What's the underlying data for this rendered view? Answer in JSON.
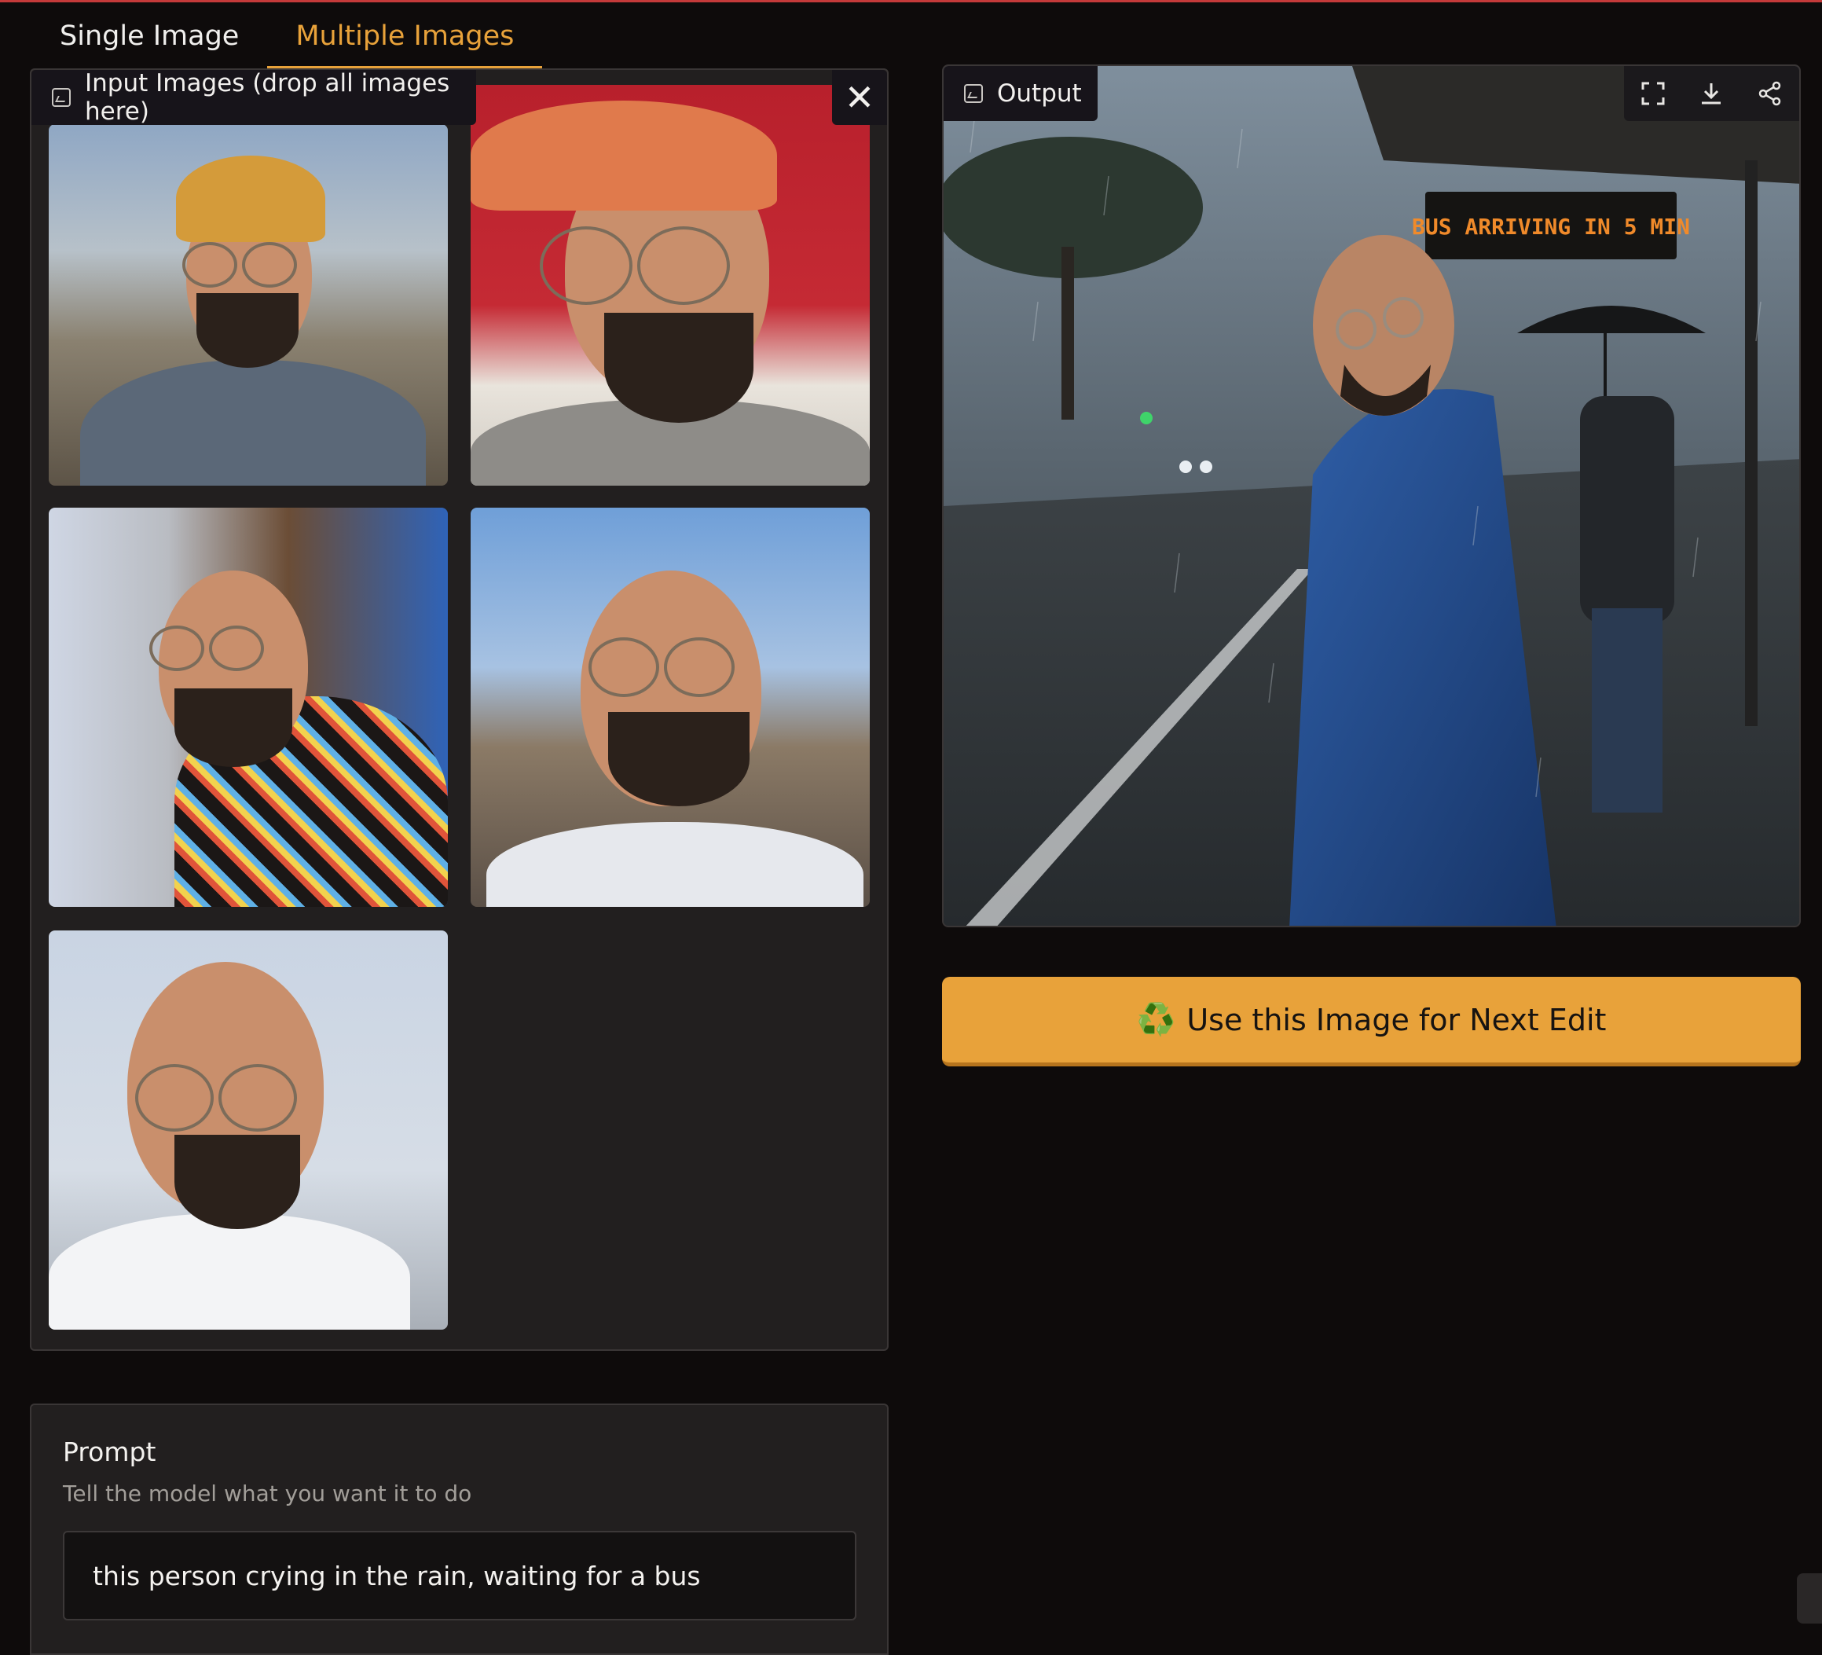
{
  "tabs": [
    {
      "label": "Single Image",
      "active": false
    },
    {
      "label": "Multiple Images",
      "active": true
    }
  ],
  "input_panel": {
    "label": "Input Images (drop all images here)",
    "label_icon": "image-icon",
    "close_icon": "close-icon",
    "thumbnails": [
      {
        "name": "input-image-1"
      },
      {
        "name": "input-image-2"
      },
      {
        "name": "input-image-3"
      },
      {
        "name": "input-image-4"
      },
      {
        "name": "input-image-5"
      }
    ]
  },
  "prompt": {
    "title": "Prompt",
    "hint": "Tell the model what you want it to do",
    "value": "this person crying in the rain, waiting for a bus"
  },
  "output_panel": {
    "label": "Output",
    "label_icon": "image-icon",
    "tools": [
      "fullscreen-icon",
      "download-icon",
      "share-icon"
    ],
    "sign_text": "BUS ARRIVING IN 5 MIN"
  },
  "next_button": {
    "icon": "♻️",
    "label": "Use this Image for Next Edit"
  },
  "colors": {
    "accent": "#e8a23a",
    "background": "#0e0b0b",
    "panel": "#221f1f"
  }
}
